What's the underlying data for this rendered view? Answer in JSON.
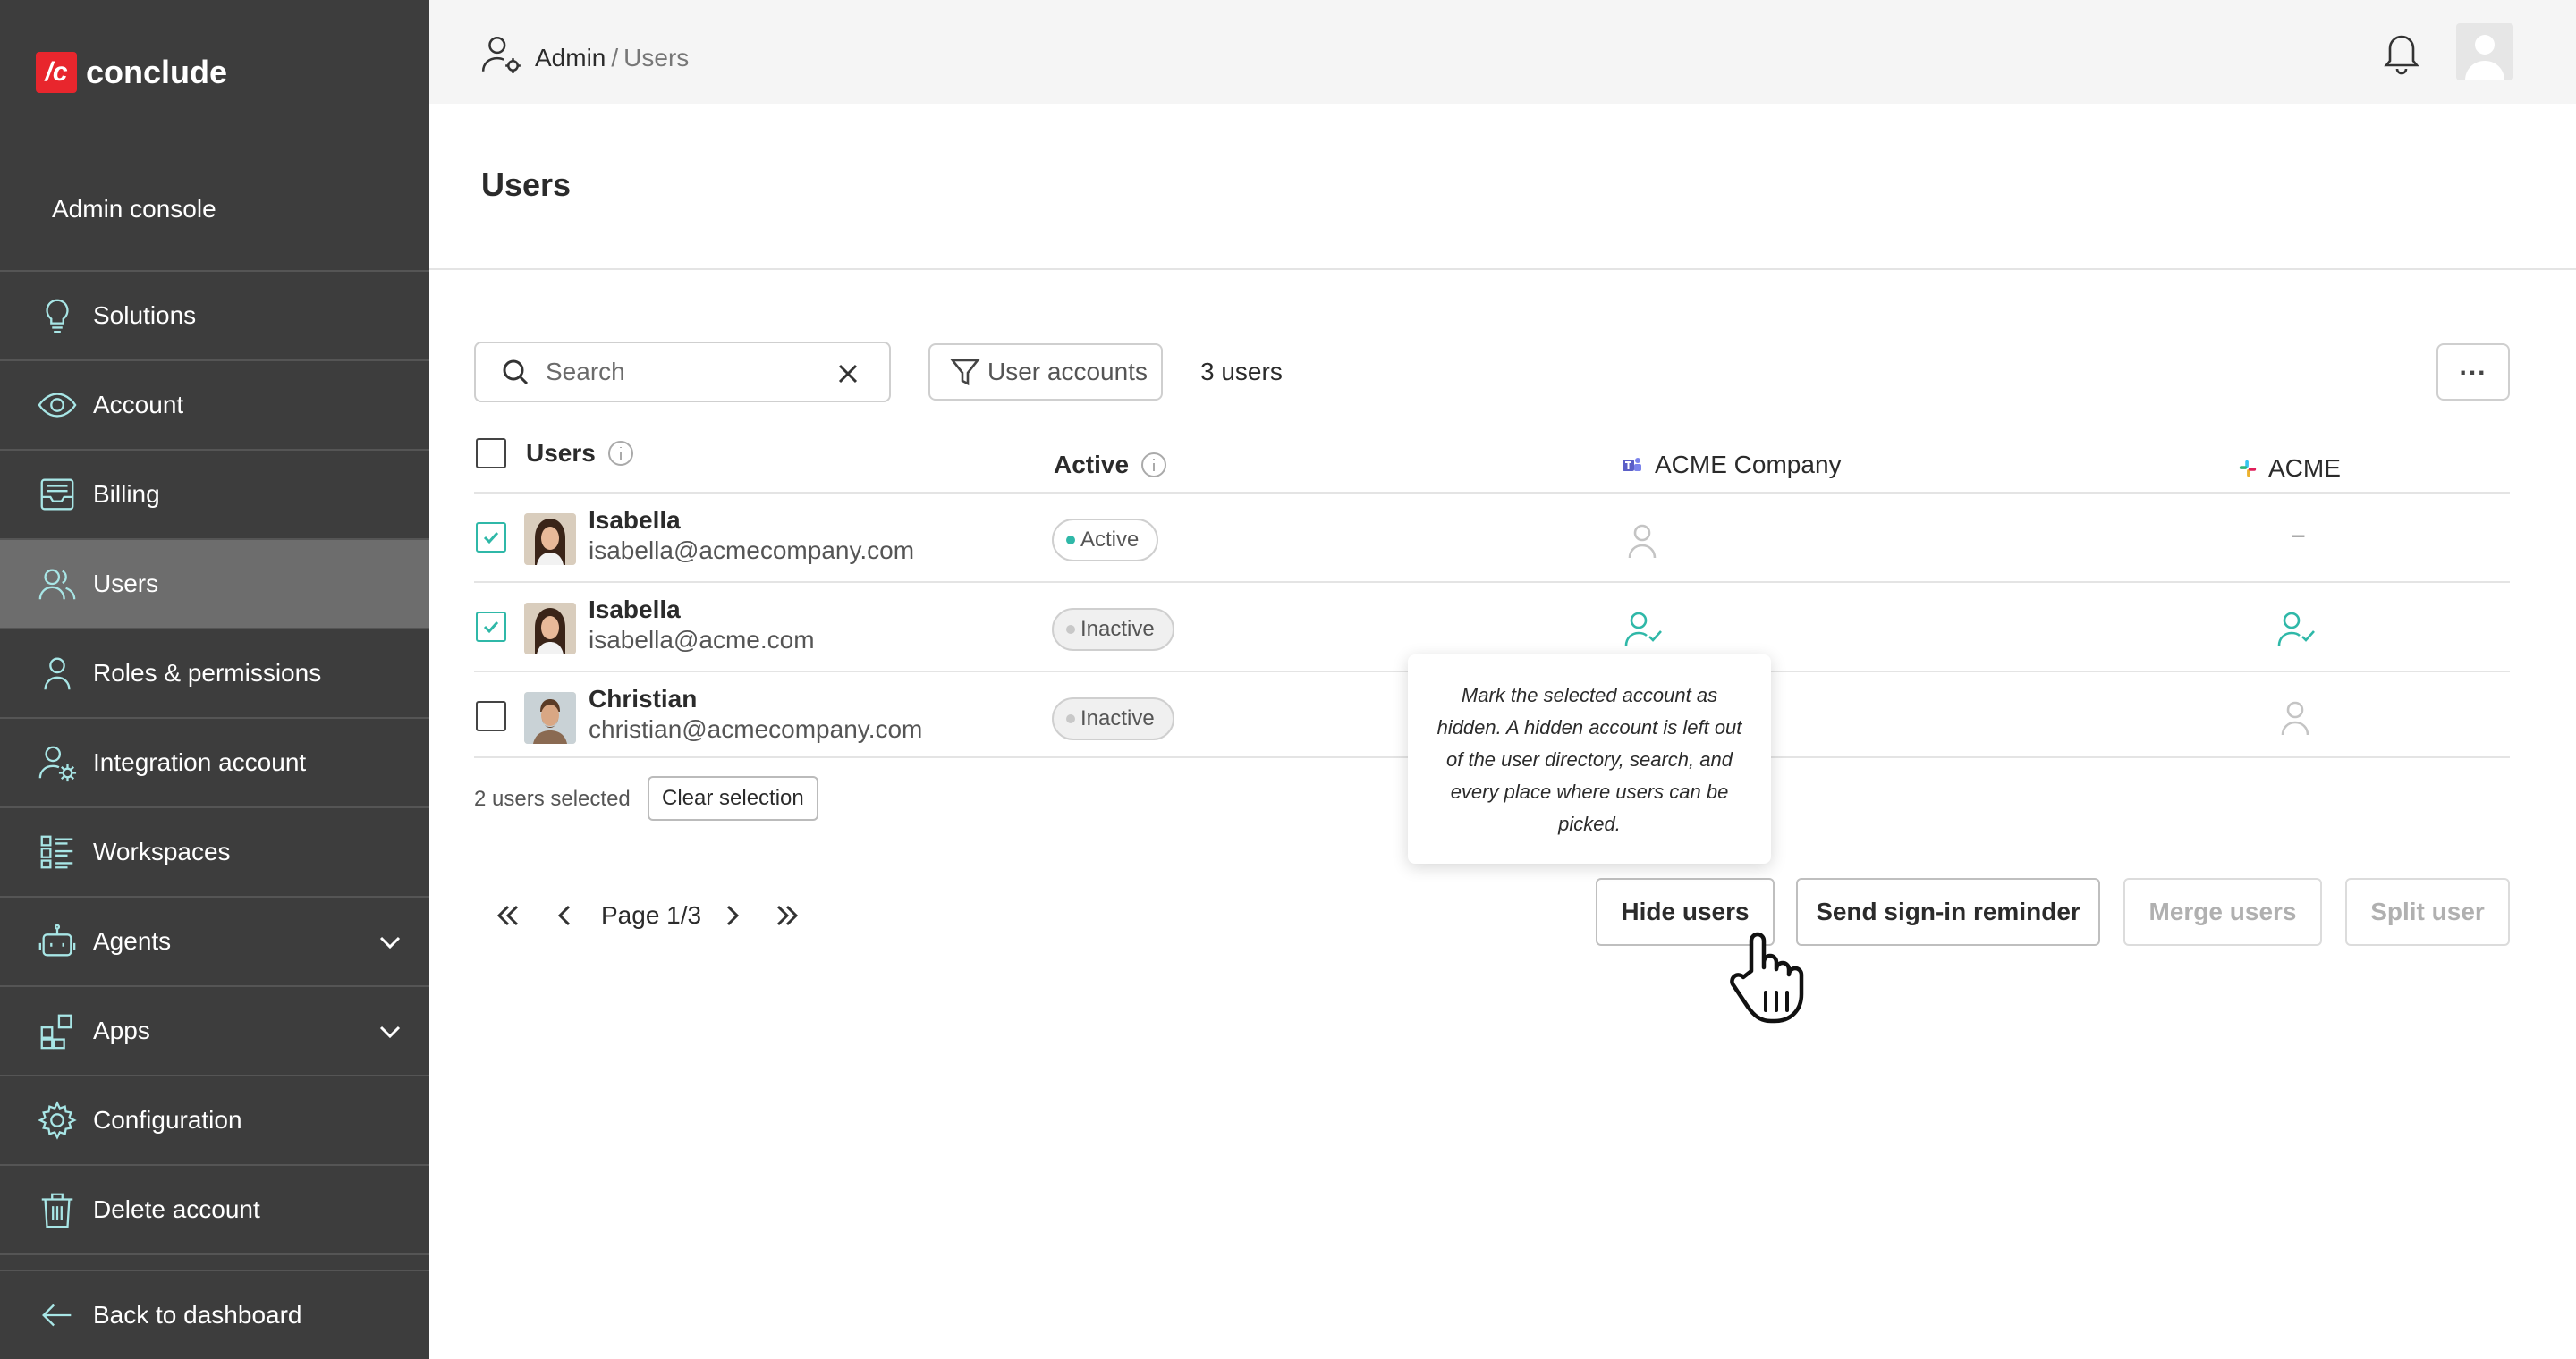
{
  "sidebar": {
    "logo_mark": "/c",
    "logo_text": "conclude",
    "console_label": "Admin console",
    "items": [
      {
        "label": "Solutions",
        "icon": "lightbulb-icon"
      },
      {
        "label": "Account",
        "icon": "eye-icon"
      },
      {
        "label": "Billing",
        "icon": "inbox-icon"
      },
      {
        "label": "Users",
        "icon": "users-icon",
        "active": true
      },
      {
        "label": "Roles & permissions",
        "icon": "person-icon"
      },
      {
        "label": "Integration account",
        "icon": "user-gear-icon"
      },
      {
        "label": "Workspaces",
        "icon": "list-icon"
      },
      {
        "label": "Agents",
        "icon": "robot-icon",
        "expandable": true
      },
      {
        "label": "Apps",
        "icon": "apps-icon",
        "expandable": true
      },
      {
        "label": "Configuration",
        "icon": "gear-icon"
      },
      {
        "label": "Delete account",
        "icon": "trash-icon"
      }
    ],
    "back_label": "Back to dashboard"
  },
  "topbar": {
    "breadcrumb_admin": "Admin",
    "breadcrumb_sep": "/",
    "breadcrumb_users": "Users"
  },
  "page": {
    "title": "Users"
  },
  "toolbar": {
    "search_placeholder": "Search",
    "filter_label": "User accounts",
    "user_count": "3 users",
    "more_label": "..."
  },
  "table": {
    "headers": {
      "users": "Users",
      "active": "Active",
      "acme_company": "ACME Company",
      "acme": "ACME"
    },
    "rows": [
      {
        "name": "Isabella",
        "email": "isabella@acmecompany.com",
        "status": "Active",
        "checked": true,
        "acme_company": "person-icon",
        "acme": "–"
      },
      {
        "name": "Isabella",
        "email": "isabella@acme.com",
        "status": "Inactive",
        "checked": true,
        "acme_company": "person-check-icon",
        "acme": "person-check-icon"
      },
      {
        "name": "Christian",
        "email": "christian@acmecompany.com",
        "status": "Inactive",
        "checked": false,
        "acme_company": "",
        "acme": "person-icon"
      }
    ]
  },
  "selection": {
    "text": "2 users selected",
    "clear_label": "Clear selection"
  },
  "pagination": {
    "label": "Page 1/3"
  },
  "actions": {
    "hide": "Hide users",
    "reminder": "Send sign-in reminder",
    "merge": "Merge users",
    "split": "Split user"
  },
  "tooltip": {
    "text": "Mark the selected account as hidden. A hidden account is left out of the user directory, search, and every place where users can be picked."
  },
  "colors": {
    "sidebar_bg": "#3d3d3d",
    "sidebar_active": "#6d6d6d",
    "accent": "#2fb8a8",
    "icon_tint": "#a8e6e6",
    "logo_red": "#e8262d"
  }
}
